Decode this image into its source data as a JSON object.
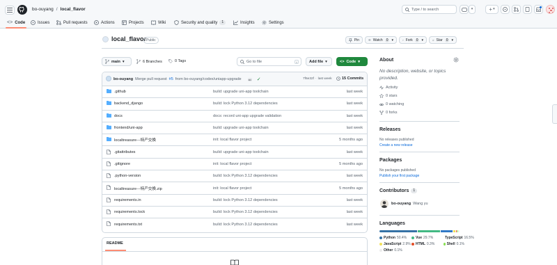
{
  "header": {
    "owner": "bo-ouyang",
    "sep": "/",
    "repo": "local_flavor",
    "search_placeholder": "Type / to search",
    "plus": "+",
    "dropdown": "▾"
  },
  "tabs": [
    {
      "label": "Code",
      "icon": "code-icon"
    },
    {
      "label": "Issues",
      "icon": "issue-icon"
    },
    {
      "label": "Pull requests",
      "icon": "pull-request-icon"
    },
    {
      "label": "Actions",
      "icon": "play-icon"
    },
    {
      "label": "Projects",
      "icon": "table-icon"
    },
    {
      "label": "Wiki",
      "icon": "book-icon"
    },
    {
      "label": "Security and quality",
      "icon": "shield-icon",
      "count": "1"
    },
    {
      "label": "Insights",
      "icon": "graph-icon"
    },
    {
      "label": "Settings",
      "icon": "gear-icon"
    }
  ],
  "repo_header": {
    "name": "local_flavor",
    "visibility": "Public",
    "pin": "Pin",
    "watch": "Watch",
    "watch_count": "0",
    "fork": "Fork",
    "fork_count": "0",
    "star": "Star",
    "star_count": "0"
  },
  "toolbar": {
    "branch": "main",
    "branches": "6 Branches",
    "tags": "0 Tags",
    "goto_placeholder": "Go to file",
    "add_file": "Add file",
    "code": "Code"
  },
  "commit": {
    "author": "bo-ouyang",
    "message_prefix": "Merge pull request",
    "pr": "#5",
    "message_suffix": "from bo-ouyang/codex/uniapp-upgrade",
    "dots": "•••",
    "sha": "7f6e32f",
    "sha_sep": "·",
    "time": "last week",
    "commits": "15 Commits"
  },
  "files": [
    {
      "name": ".github",
      "type": "dir",
      "msg": "build: upgrade uni-app toolchain",
      "date": "last week"
    },
    {
      "name": "backend_django",
      "type": "dir",
      "msg": "build: lock Python 3.12 dependencies",
      "date": "last week"
    },
    {
      "name": "docs",
      "type": "dir",
      "msg": "docs: record uni-app upgrade validation",
      "date": "last week"
    },
    {
      "name": "frontend/uni-app",
      "type": "dir",
      "msg": "build: upgrade uni-app toolchain",
      "date": "last week"
    },
    {
      "name": "localtreasure---特产交换",
      "type": "dir",
      "msg": "init: local flavor project",
      "date": "5 months ago"
    },
    {
      "name": ".gitattributes",
      "type": "file",
      "msg": "build: upgrade uni-app toolchain",
      "date": "last week"
    },
    {
      "name": ".gitignore",
      "type": "file",
      "msg": "init: local flavor project",
      "date": "5 months ago"
    },
    {
      "name": ".python-version",
      "type": "file",
      "msg": "build: lock Python 3.12 dependencies",
      "date": "last week"
    },
    {
      "name": "localtreasure---特产交换.zip",
      "type": "file",
      "msg": "init: local flavor project",
      "date": "5 months ago"
    },
    {
      "name": "requirements.in",
      "type": "file",
      "msg": "build: lock Python 3.12 dependencies",
      "date": "last week"
    },
    {
      "name": "requirements.lock",
      "type": "file",
      "msg": "build: lock Python 3.12 dependencies",
      "date": "last week"
    },
    {
      "name": "requirements.txt",
      "type": "file",
      "msg": "build: lock Python 3.12 dependencies",
      "date": "last week"
    }
  ],
  "readme": {
    "title": "README"
  },
  "about": {
    "title": "About",
    "desc": "No description, website, or topics provided.",
    "activity": "Activity",
    "stars": "0 stars",
    "watching": "0 watching",
    "forks": "0 forks"
  },
  "releases": {
    "title": "Releases",
    "none": "No releases published",
    "link": "Create a new release"
  },
  "packages": {
    "title": "Packages",
    "none": "No packages published",
    "link": "Publish your first package"
  },
  "contributors": {
    "title": "Contributors",
    "count": "1",
    "login": "bo-ouyang",
    "name": "Wang yu"
  },
  "languages": {
    "title": "Languages",
    "items": [
      {
        "name": "Python",
        "pct": "50.4%",
        "value": 50.4,
        "color": "#3572A5"
      },
      {
        "name": "Vue",
        "pct": "29.7%",
        "value": 29.7,
        "color": "#41b883"
      },
      {
        "name": "TypeScript",
        "pct": "16.5%",
        "value": 16.5,
        "color": "#3178c6"
      },
      {
        "name": "JavaScript",
        "pct": "2.9%",
        "value": 2.9,
        "color": "#f1e05a"
      },
      {
        "name": "HTML",
        "pct": "0.3%",
        "value": 0.3,
        "color": "#e34c26"
      },
      {
        "name": "Shell",
        "pct": "0.1%",
        "value": 0.1,
        "color": "#89e051"
      },
      {
        "name": "Other",
        "pct": "0.1%",
        "value": 0.1,
        "color": "#ededed"
      }
    ]
  },
  "colors": {
    "accent": "#0969da",
    "green": "#1f883d",
    "border": "#d1d9e0",
    "folder": "#54aeff"
  }
}
